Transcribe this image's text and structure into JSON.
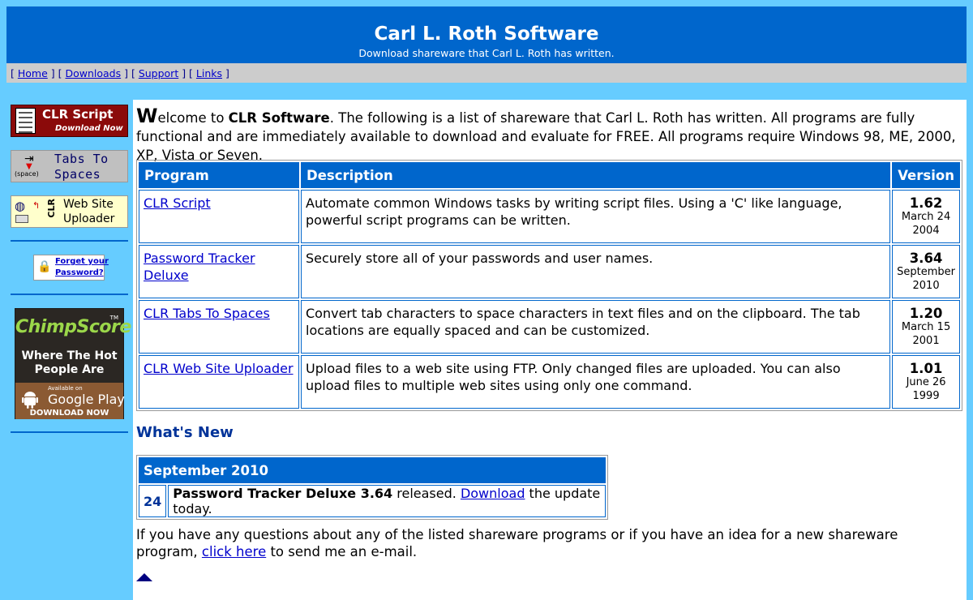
{
  "header": {
    "title": "Carl L. Roth Software",
    "tagline": "Download shareware that Carl L. Roth has written."
  },
  "nav": {
    "home": "Home",
    "downloads": "Downloads",
    "support": "Support",
    "links": "Links"
  },
  "sidebar": {
    "clrscript": {
      "line1": "CLR Script",
      "line2": "Download Now"
    },
    "tabs": {
      "line1": "Tabs To",
      "line2": "Spaces",
      "space_label": "(space)"
    },
    "uploader": {
      "clr": "CLR",
      "line1": "Web Site",
      "line2": "Uploader"
    },
    "forgot": {
      "line1": "Forget your",
      "line2": "Password?"
    },
    "chimp": {
      "logo": "ChimpScore",
      "tm": "TM",
      "line1": "Where The Hot",
      "line2": "People Are",
      "available": "Available on",
      "store": "Google Play",
      "download": "DOWNLOAD NOW"
    }
  },
  "intro": {
    "cap": "W",
    "after_cap": "elcome to ",
    "brand": "CLR Software",
    "rest": ". The following is a list of shareware that Carl L. Roth has written. All programs are fully functional and are immediately available to download and evaluate for FREE. All programs require Windows 98, ME, 2000, XP, Vista or Seven."
  },
  "programs": {
    "headers": {
      "program": "Program",
      "description": "Description",
      "version": "Version"
    },
    "rows": [
      {
        "name": "CLR Script",
        "description": "Automate common Windows tasks by writing script files. Using a 'C' like language, powerful script programs can be written.",
        "version": "1.62",
        "date1": "March 24",
        "date2": "2004"
      },
      {
        "name": "Password Tracker Deluxe",
        "description": "Securely store all of your passwords and user names.",
        "version": "3.64",
        "date1": "September",
        "date2": "2010"
      },
      {
        "name": "CLR Tabs To Spaces",
        "description": "Convert tab characters to space characters in text files and on the clipboard. The tab locations are equally spaced and can be customized.",
        "version": "1.20",
        "date1": "March 15",
        "date2": "2001"
      },
      {
        "name": "CLR Web Site Uploader",
        "description": "Upload files to a web site using FTP. Only changed files are uploaded. You can also upload files to multiple web sites using only one command.",
        "version": "1.01",
        "date1": "June 26",
        "date2": "1999"
      }
    ]
  },
  "whats_new": {
    "title": "What's New",
    "month": "September 2010",
    "day": "24",
    "product": "Password Tracker Deluxe 3.64",
    "released": " released. ",
    "link": "Download",
    "tail": " the update today."
  },
  "contact": {
    "text": "If you have any questions about any of the listed shareware programs or if you have an idea for a new shareware program, ",
    "link": "click here",
    "tail": " to send me an e-mail."
  },
  "colors": {
    "page_bg": "#66ccff",
    "header_bg": "#0066cc",
    "nav_bg": "#cccccc",
    "link": "#0000cc"
  },
  "icons": [
    "tab-arrow-icon",
    "globe-icon",
    "lock-icon",
    "android-icon",
    "up-arrow-icon"
  ]
}
